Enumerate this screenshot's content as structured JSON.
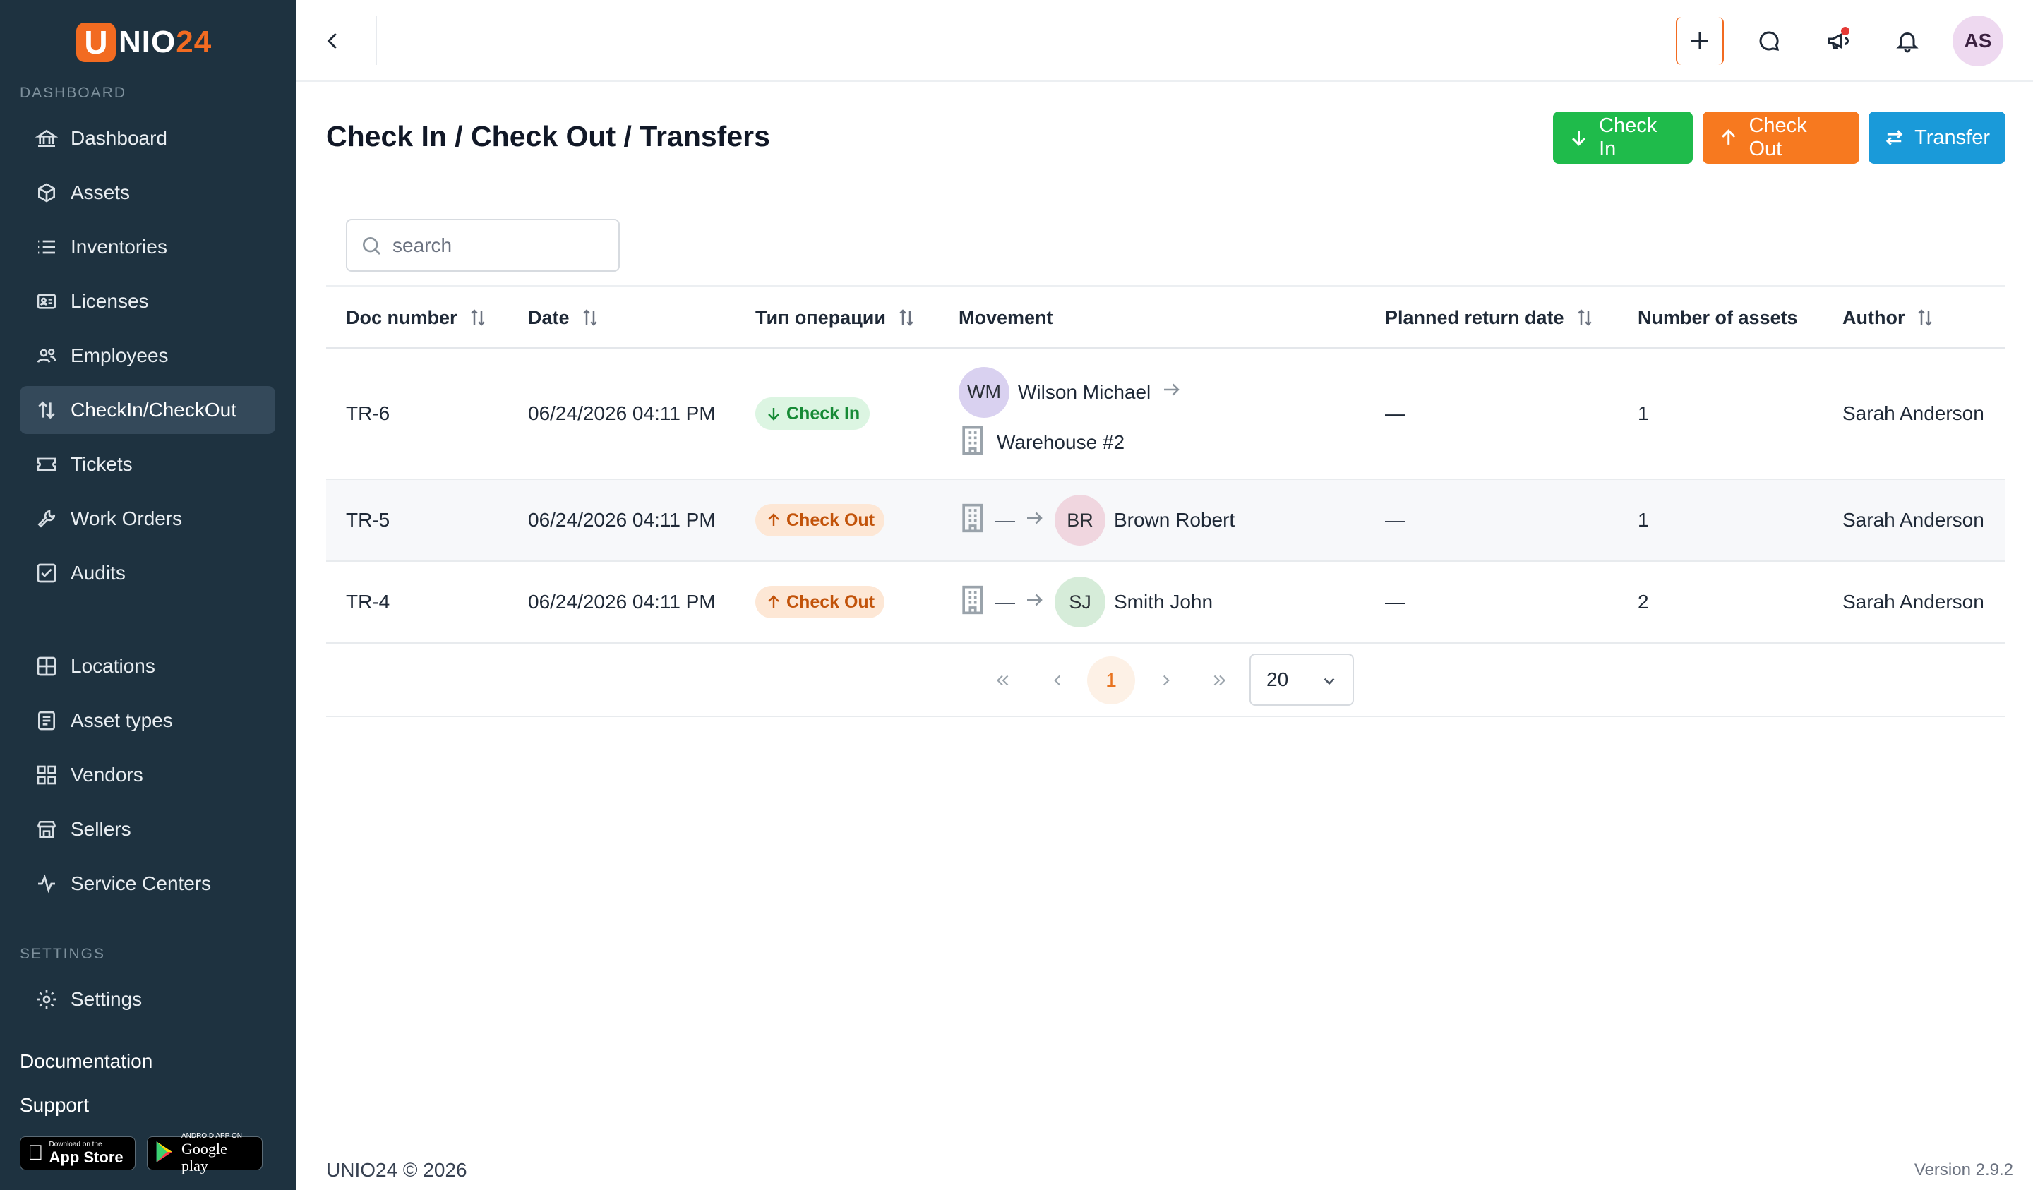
{
  "brand": {
    "logo_letter": "U",
    "logo_text_main": "NIO",
    "logo_text_accent": "24",
    "accent_color": "#f26b21",
    "sidebar_bg": "#1e3240"
  },
  "sidebar": {
    "section_dashboard": "DASHBOARD",
    "items": [
      {
        "label": "Dashboard",
        "icon": "bank-icon"
      },
      {
        "label": "Assets",
        "icon": "cube-icon"
      },
      {
        "label": "Inventories",
        "icon": "list-icon"
      },
      {
        "label": "Licenses",
        "icon": "id-card-icon"
      },
      {
        "label": "Employees",
        "icon": "users-icon"
      },
      {
        "label": "CheckIn/CheckOut",
        "icon": "arrows-up-down-icon",
        "active": true
      },
      {
        "label": "Tickets",
        "icon": "ticket-icon"
      },
      {
        "label": "Work Orders",
        "icon": "wrench-icon"
      },
      {
        "label": "Audits",
        "icon": "checkbox-icon"
      },
      {
        "label": "Locations",
        "icon": "grid-icon"
      },
      {
        "label": "Asset types",
        "icon": "document-icon"
      },
      {
        "label": "Vendors",
        "icon": "apps-icon"
      },
      {
        "label": "Sellers",
        "icon": "store-icon"
      },
      {
        "label": "Service Centers",
        "icon": "pulse-icon"
      }
    ],
    "section_settings": "SETTINGS",
    "settings_item": {
      "label": "Settings",
      "icon": "gear-icon"
    },
    "documentation": "Documentation",
    "support": "Support",
    "app_store": {
      "small": "Download on the",
      "big": "App Store"
    },
    "google_play": {
      "small": "ANDROID APP ON",
      "big": "Google play"
    }
  },
  "topbar": {
    "avatar_initials": "AS"
  },
  "page": {
    "title": "Check In / Check Out / Transfers",
    "buttons": {
      "check_in": "Check In",
      "check_out": "Check Out",
      "transfer": "Transfer"
    },
    "search_placeholder": "search"
  },
  "table": {
    "headers": {
      "doc_number": "Doc number",
      "date": "Date",
      "operation_type": "Тип операции",
      "movement": "Movement",
      "planned_return": "Planned return date",
      "num_assets": "Number of assets",
      "author": "Author"
    },
    "rows": [
      {
        "doc": "TR-6",
        "date": "06/24/2026 04:11 PM",
        "type": "Check In",
        "from_initials": "WM",
        "from_name": "Wilson Michael",
        "to_location": "Warehouse #2",
        "return_date": "—",
        "assets": "1",
        "author": "Sarah Anderson"
      },
      {
        "doc": "TR-5",
        "date": "06/24/2026 04:11 PM",
        "type": "Check Out",
        "from_dash": "—",
        "to_initials": "BR",
        "to_name": "Brown Robert",
        "return_date": "—",
        "assets": "1",
        "author": "Sarah Anderson"
      },
      {
        "doc": "TR-4",
        "date": "06/24/2026 04:11 PM",
        "type": "Check Out",
        "from_dash": "—",
        "to_initials": "SJ",
        "to_name": "Smith John",
        "return_date": "—",
        "assets": "2",
        "author": "Sarah Anderson"
      }
    ]
  },
  "pagination": {
    "current_page": "1",
    "page_size": "20"
  },
  "footer": {
    "copyright": "UNIO24 © 2026",
    "version": "Version 2.9.2"
  }
}
